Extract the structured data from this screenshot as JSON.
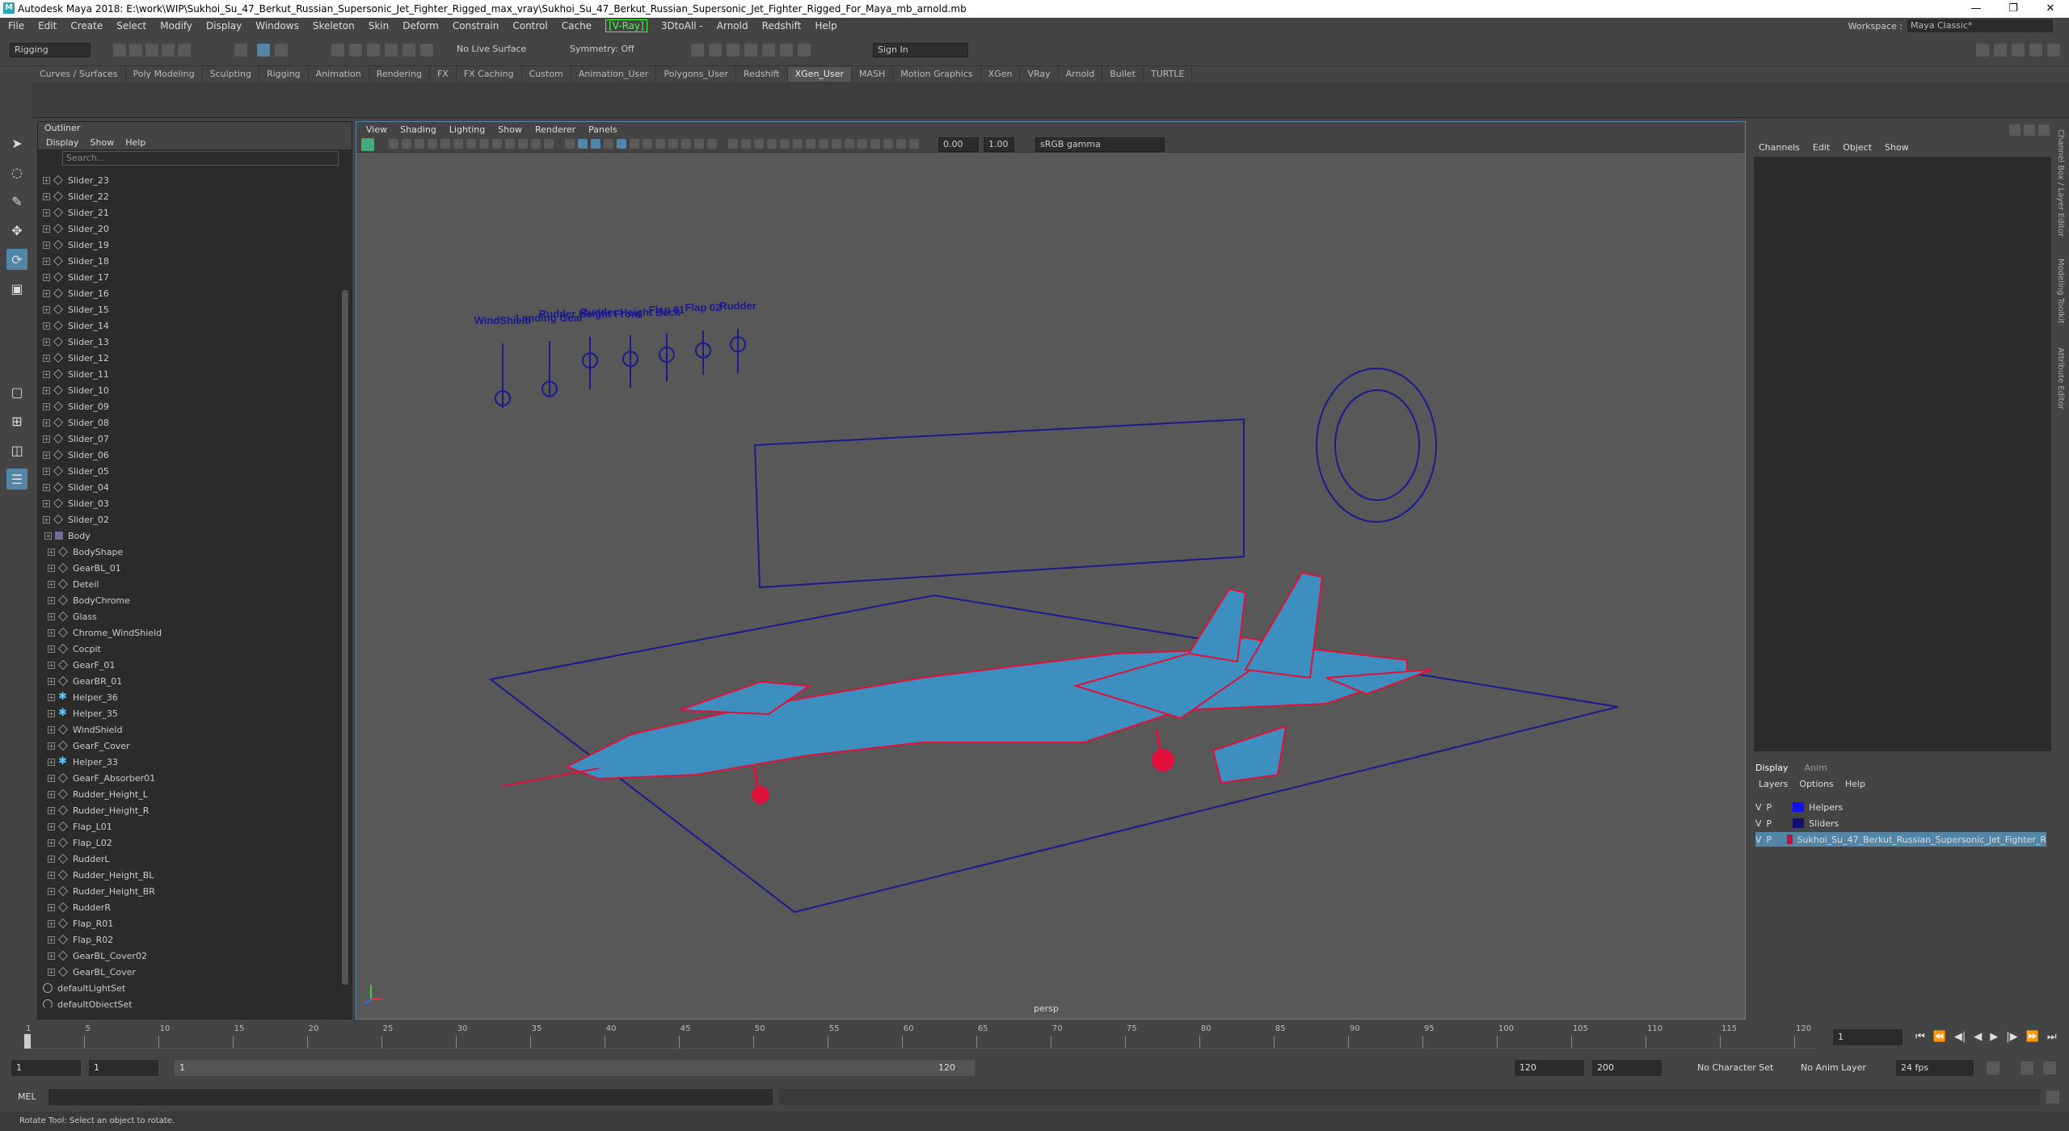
{
  "title": "Autodesk Maya 2018: E:\\work\\WIP\\Sukhoi_Su_47_Berkut_Russian_Supersonic_Jet_Fighter_Rigged_max_vray\\Sukhoi_Su_47_Berkut_Russian_Supersonic_Jet_Fighter_Rigged_For_Maya_mb_arnold.mb",
  "window_controls": [
    "—",
    "❐",
    "✕"
  ],
  "menu": [
    "File",
    "Edit",
    "Create",
    "Select",
    "Modify",
    "Display",
    "Windows",
    "Skeleton",
    "Skin",
    "Deform",
    "Constrain",
    "Control",
    "Cache",
    "[V-Ray]",
    "3DtoAll -",
    "Arnold",
    "Redshift",
    "Help"
  ],
  "workspace": {
    "label": "Workspace :",
    "value": "Maya Classic*"
  },
  "status": {
    "mode": "Rigging",
    "live_surface": "No Live Surface",
    "symmetry": "Symmetry: Off",
    "sign_in": "Sign In"
  },
  "shelf_tabs": [
    "Curves / Surfaces",
    "Poly Modeling",
    "Sculpting",
    "Rigging",
    "Animation",
    "Rendering",
    "FX",
    "FX Caching",
    "Custom",
    "Animation_User",
    "Polygons_User",
    "Redshift",
    "XGen_User",
    "MASH",
    "Motion Graphics",
    "XGen",
    "VRay",
    "Arnold",
    "Bullet",
    "TURTLE"
  ],
  "shelf_active": "XGen_User",
  "outliner": {
    "title": "Outliner",
    "menu": [
      "Display",
      "Show",
      "Help"
    ],
    "search_placeholder": "Search...",
    "items": [
      {
        "label": "Slider_23",
        "indent": 1,
        "icon": "transform"
      },
      {
        "label": "Slider_22",
        "indent": 1,
        "icon": "transform"
      },
      {
        "label": "Slider_21",
        "indent": 1,
        "icon": "transform"
      },
      {
        "label": "Slider_20",
        "indent": 1,
        "icon": "transform"
      },
      {
        "label": "Slider_19",
        "indent": 1,
        "icon": "transform"
      },
      {
        "label": "Slider_18",
        "indent": 1,
        "icon": "transform"
      },
      {
        "label": "Slider_17",
        "indent": 1,
        "icon": "transform"
      },
      {
        "label": "Slider_16",
        "indent": 1,
        "icon": "transform"
      },
      {
        "label": "Slider_15",
        "indent": 1,
        "icon": "transform"
      },
      {
        "label": "Slider_14",
        "indent": 1,
        "icon": "transform"
      },
      {
        "label": "Slider_13",
        "indent": 1,
        "icon": "transform"
      },
      {
        "label": "Slider_12",
        "indent": 1,
        "icon": "transform"
      },
      {
        "label": "Slider_11",
        "indent": 1,
        "icon": "transform"
      },
      {
        "label": "Slider_10",
        "indent": 1,
        "icon": "transform"
      },
      {
        "label": "Slider_09",
        "indent": 1,
        "icon": "transform"
      },
      {
        "label": "Slider_08",
        "indent": 1,
        "icon": "transform"
      },
      {
        "label": "Slider_07",
        "indent": 1,
        "icon": "transform"
      },
      {
        "label": "Slider_06",
        "indent": 1,
        "icon": "transform"
      },
      {
        "label": "Slider_05",
        "indent": 1,
        "icon": "transform"
      },
      {
        "label": "Slider_04",
        "indent": 1,
        "icon": "transform"
      },
      {
        "label": "Slider_03",
        "indent": 1,
        "icon": "transform"
      },
      {
        "label": "Slider_02",
        "indent": 1,
        "icon": "transform"
      },
      {
        "label": "Body",
        "indent": 0,
        "icon": "group"
      },
      {
        "label": "BodyShape",
        "indent": 2,
        "icon": "transform"
      },
      {
        "label": "GearBL_01",
        "indent": 2,
        "icon": "transform"
      },
      {
        "label": "Deteil",
        "indent": 2,
        "icon": "transform"
      },
      {
        "label": "BodyChrome",
        "indent": 2,
        "icon": "transform"
      },
      {
        "label": "Glass",
        "indent": 2,
        "icon": "transform"
      },
      {
        "label": "Chrome_WindShield",
        "indent": 2,
        "icon": "transform"
      },
      {
        "label": "Cocpit",
        "indent": 2,
        "icon": "transform"
      },
      {
        "label": "GearF_01",
        "indent": 2,
        "icon": "transform"
      },
      {
        "label": "GearBR_01",
        "indent": 2,
        "icon": "transform"
      },
      {
        "label": "Helper_36",
        "indent": 2,
        "icon": "helper"
      },
      {
        "label": "Helper_35",
        "indent": 2,
        "icon": "helper"
      },
      {
        "label": "WindShield",
        "indent": 2,
        "icon": "transform"
      },
      {
        "label": "GearF_Cover",
        "indent": 2,
        "icon": "transform"
      },
      {
        "label": "Helper_33",
        "indent": 2,
        "icon": "helper"
      },
      {
        "label": "GearF_Absorber01",
        "indent": 2,
        "icon": "transform"
      },
      {
        "label": "Rudder_Height_L",
        "indent": 2,
        "icon": "transform"
      },
      {
        "label": "Rudder_Height_R",
        "indent": 2,
        "icon": "transform"
      },
      {
        "label": "Flap_L01",
        "indent": 2,
        "icon": "transform"
      },
      {
        "label": "Flap_L02",
        "indent": 2,
        "icon": "transform"
      },
      {
        "label": "RudderL",
        "indent": 2,
        "icon": "transform"
      },
      {
        "label": "Rudder_Height_BL",
        "indent": 2,
        "icon": "transform"
      },
      {
        "label": "Rudder_Height_BR",
        "indent": 2,
        "icon": "transform"
      },
      {
        "label": "RudderR",
        "indent": 2,
        "icon": "transform"
      },
      {
        "label": "Flap_R01",
        "indent": 2,
        "icon": "transform"
      },
      {
        "label": "Flap_R02",
        "indent": 2,
        "icon": "transform"
      },
      {
        "label": "GearBL_Cover02",
        "indent": 2,
        "icon": "transform"
      },
      {
        "label": "GearBL_Cover",
        "indent": 2,
        "icon": "transform"
      },
      {
        "label": "defaultLightSet",
        "indent": 0,
        "icon": "set"
      },
      {
        "label": "defaultObjectSet",
        "indent": 0,
        "icon": "set"
      }
    ]
  },
  "viewport": {
    "menu": [
      "View",
      "Shading",
      "Lighting",
      "Show",
      "Renderer",
      "Panels"
    ],
    "exposure": "0.00",
    "gamma": "1.00",
    "color_space": "sRGB gamma",
    "camera": "persp",
    "slider_labels": [
      "WindShield",
      "Landing Gear",
      "Rudder Height Front",
      "Rudder Height Back",
      "Flap 01",
      "Flap 02",
      "Rudder"
    ],
    "colors": {
      "wire_blue": "#1a1a8c",
      "wire_red": "#e0103a",
      "body": "#3d8fc0"
    }
  },
  "channel_box": {
    "menu": [
      "Channels",
      "Edit",
      "Object",
      "Show"
    ]
  },
  "side_tabs": [
    "Channel Box / Layer Editor",
    "Modeling Toolkit",
    "Attribute Editor"
  ],
  "layer_editor": {
    "tabs": [
      "Display",
      "Anim"
    ],
    "menu": [
      "Layers",
      "Options",
      "Help"
    ],
    "layers": [
      {
        "v": "V",
        "p": "P",
        "color": "#1010ee",
        "name": "Helpers",
        "selected": false
      },
      {
        "v": "V",
        "p": "P",
        "color": "#101070",
        "name": "Sliders",
        "selected": false
      },
      {
        "v": "V",
        "p": "P",
        "color": "#c01040",
        "name": "Sukhoi_Su_47_Berkut_Russian_Supersonic_Jet_Fighter_R",
        "selected": true
      }
    ]
  },
  "time_slider": {
    "ticks": [
      "1",
      "5",
      "10",
      "15",
      "20",
      "25",
      "30",
      "35",
      "40",
      "45",
      "50",
      "55",
      "60",
      "65",
      "70",
      "75",
      "80",
      "85",
      "90",
      "95",
      "100",
      "105",
      "110",
      "115",
      "120"
    ],
    "current_frame": "1"
  },
  "range": {
    "start": "1",
    "inner_start": "1",
    "slider_start": "1",
    "slider_end": "120",
    "end": "120",
    "max": "200",
    "char_set": "No Character Set",
    "anim_layer": "No Anim Layer",
    "fps": "24 fps"
  },
  "cmd": {
    "label": "MEL"
  },
  "help_line": "Rotate Tool: Select an object to rotate."
}
